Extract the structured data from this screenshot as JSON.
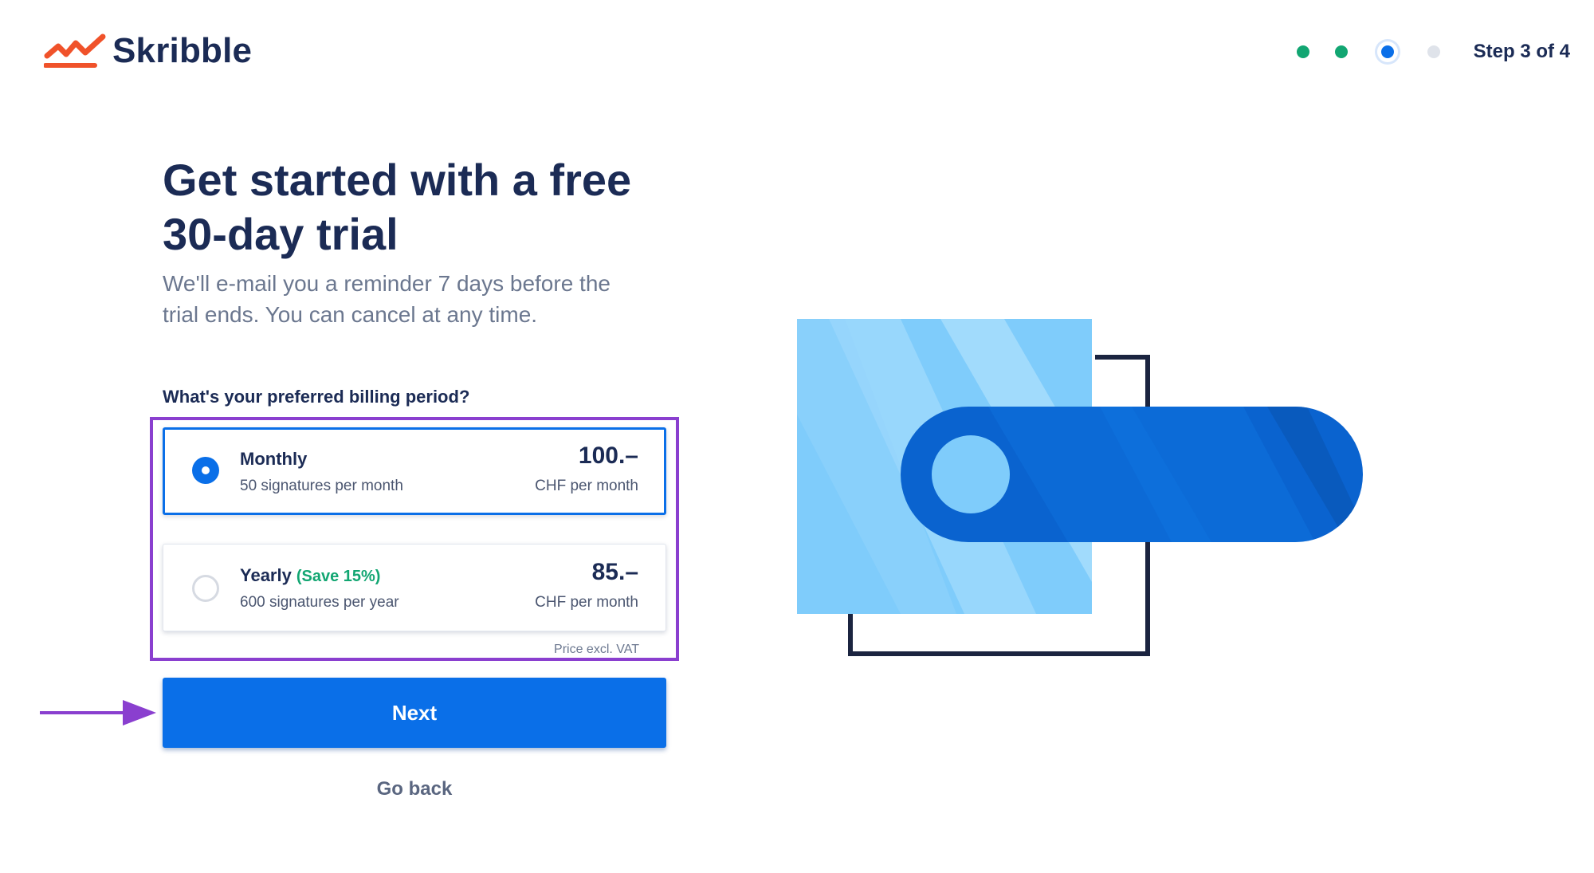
{
  "brand": {
    "name": "Skribble"
  },
  "stepper": {
    "label": "Step 3 of 4",
    "steps": [
      "done",
      "done",
      "active",
      "todo"
    ]
  },
  "hero": {
    "headline_line1": "Get started with a free",
    "headline_line2": "30-day trial",
    "subline_line1": "We'll e-mail you a reminder 7 days before the",
    "subline_line2": "trial ends. You can cancel at any time."
  },
  "billing": {
    "question": "What's your preferred billing period?",
    "options": [
      {
        "title": "Monthly",
        "save": "",
        "description": "50 signatures per month",
        "price": "100.–",
        "unit": "CHF per month",
        "selected": true
      },
      {
        "title": "Yearly",
        "save": "(Save 15%)",
        "description": "600 signatures per year",
        "price": "85.–",
        "unit": "CHF per month",
        "selected": false
      }
    ],
    "vat_note": "Price excl. VAT"
  },
  "actions": {
    "next_label": "Next",
    "back_label": "Go back"
  },
  "colors": {
    "primary": "#0a6fe8",
    "navy": "#1b2b55",
    "success": "#12a672",
    "logo_orange": "#f0522a",
    "annotation_purple": "#8a3fcf",
    "light_blue": "#7fccfb"
  },
  "icons": {
    "logo": "skribble-signature-logo-icon",
    "arrow": "annotation-arrow-icon",
    "illustration": "toggle-switch-illustration"
  }
}
